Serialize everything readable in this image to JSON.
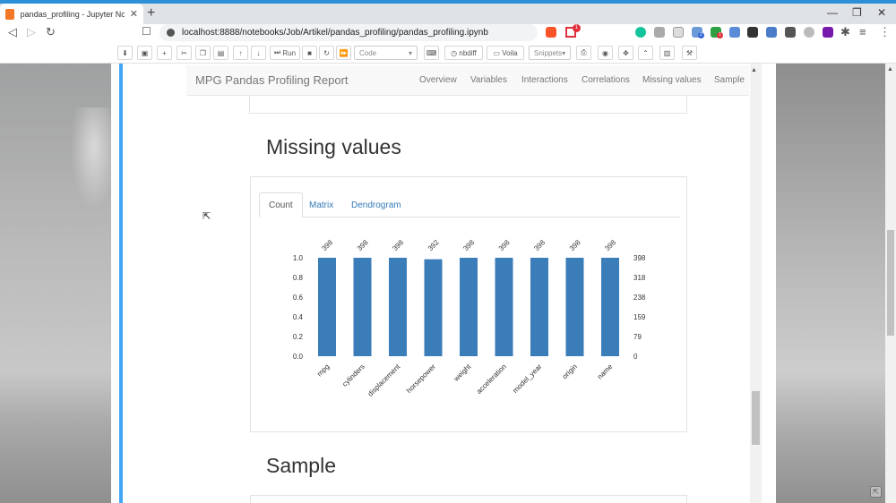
{
  "browser": {
    "tab_title": "pandas_profiling - Jupyter Noteb...",
    "url": "localhost:8888/notebooks/Job/Artikel/pandas_profiling/pandas_profiling.ipynb",
    "notification_count": "1",
    "ext_badge_a": "2",
    "ext_badge_b": "1"
  },
  "toolbar": {
    "run_label": "Run",
    "cell_type": "Code",
    "nbdiff_label": "nbdiff",
    "voila_label": "Voila",
    "snippets_label": "Snippets"
  },
  "report": {
    "brand": "MPG Pandas Profiling Report",
    "nav": [
      "Overview",
      "Variables",
      "Interactions",
      "Correlations",
      "Missing values",
      "Sample"
    ],
    "section_missing": "Missing values",
    "section_sample": "Sample",
    "tabs": [
      "Count",
      "Matrix",
      "Dendrogram"
    ]
  },
  "chart_data": {
    "type": "bar",
    "categories": [
      "mpg",
      "cylinders",
      "displacement",
      "horsepower",
      "weight",
      "acceleration",
      "model_year",
      "origin",
      "name"
    ],
    "values": [
      1.0,
      1.0,
      1.0,
      0.985,
      1.0,
      1.0,
      1.0,
      1.0,
      1.0
    ],
    "counts": [
      "398",
      "398",
      "398",
      "392",
      "398",
      "398",
      "398",
      "398",
      "398"
    ],
    "ylim": [
      0,
      1.0
    ],
    "yticks": [
      "0.0",
      "0.2",
      "0.4",
      "0.6",
      "0.8",
      "1.0"
    ],
    "right_ticks": [
      "0",
      "79",
      "159",
      "238",
      "318",
      "398"
    ],
    "bar_color": "#3a7db8"
  },
  "colors": {
    "accent": "#42a5f5",
    "link": "#337ab7"
  }
}
